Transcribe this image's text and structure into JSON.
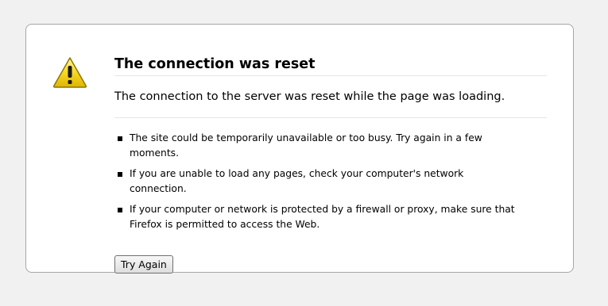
{
  "error_page": {
    "title": "The connection was reset",
    "short_description": "The connection to the server was reset while the page was loading.",
    "hints": [
      "The site could be temporarily unavailable or too busy. Try again in a few moments.",
      "If you are unable to load any pages, check your computer's network connection.",
      "If your computer or network is protected by a firewall or proxy, make sure that Firefox is permitted to access the Web."
    ],
    "try_again_label": "Try Again",
    "icon": "warning-triangle-icon"
  },
  "colors": {
    "page_background": "#f1f1f1",
    "box_background": "#ffffff",
    "box_border": "#a6a6a6",
    "warning_yellow": "#f5d300"
  }
}
